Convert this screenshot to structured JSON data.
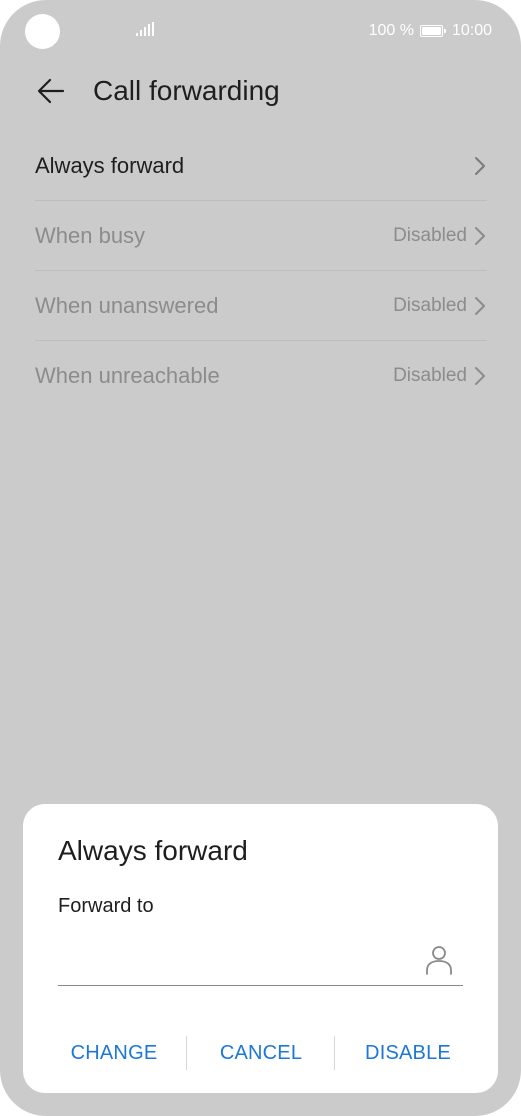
{
  "status_bar": {
    "battery_percent": "100 %",
    "time": "10:00"
  },
  "header": {
    "title": "Call forwarding"
  },
  "rows": [
    {
      "label": "Always forward",
      "value": ""
    },
    {
      "label": "When busy",
      "value": "Disabled"
    },
    {
      "label": "When unanswered",
      "value": "Disabled"
    },
    {
      "label": "When unreachable",
      "value": "Disabled"
    }
  ],
  "dialog": {
    "title": "Always forward",
    "field_label": "Forward to",
    "field_value": "",
    "buttons": {
      "change": "CHANGE",
      "cancel": "CANCEL",
      "disable": "DISABLE"
    }
  },
  "colors": {
    "background_dim": "#cbcbcb",
    "accent": "#1c78d4",
    "text_primary": "#1e1e1e",
    "text_disabled": "#8c8c8c"
  },
  "icons": [
    "signal-icon",
    "battery-icon",
    "back-arrow-icon",
    "chevron-right-icon",
    "contact-icon"
  ]
}
